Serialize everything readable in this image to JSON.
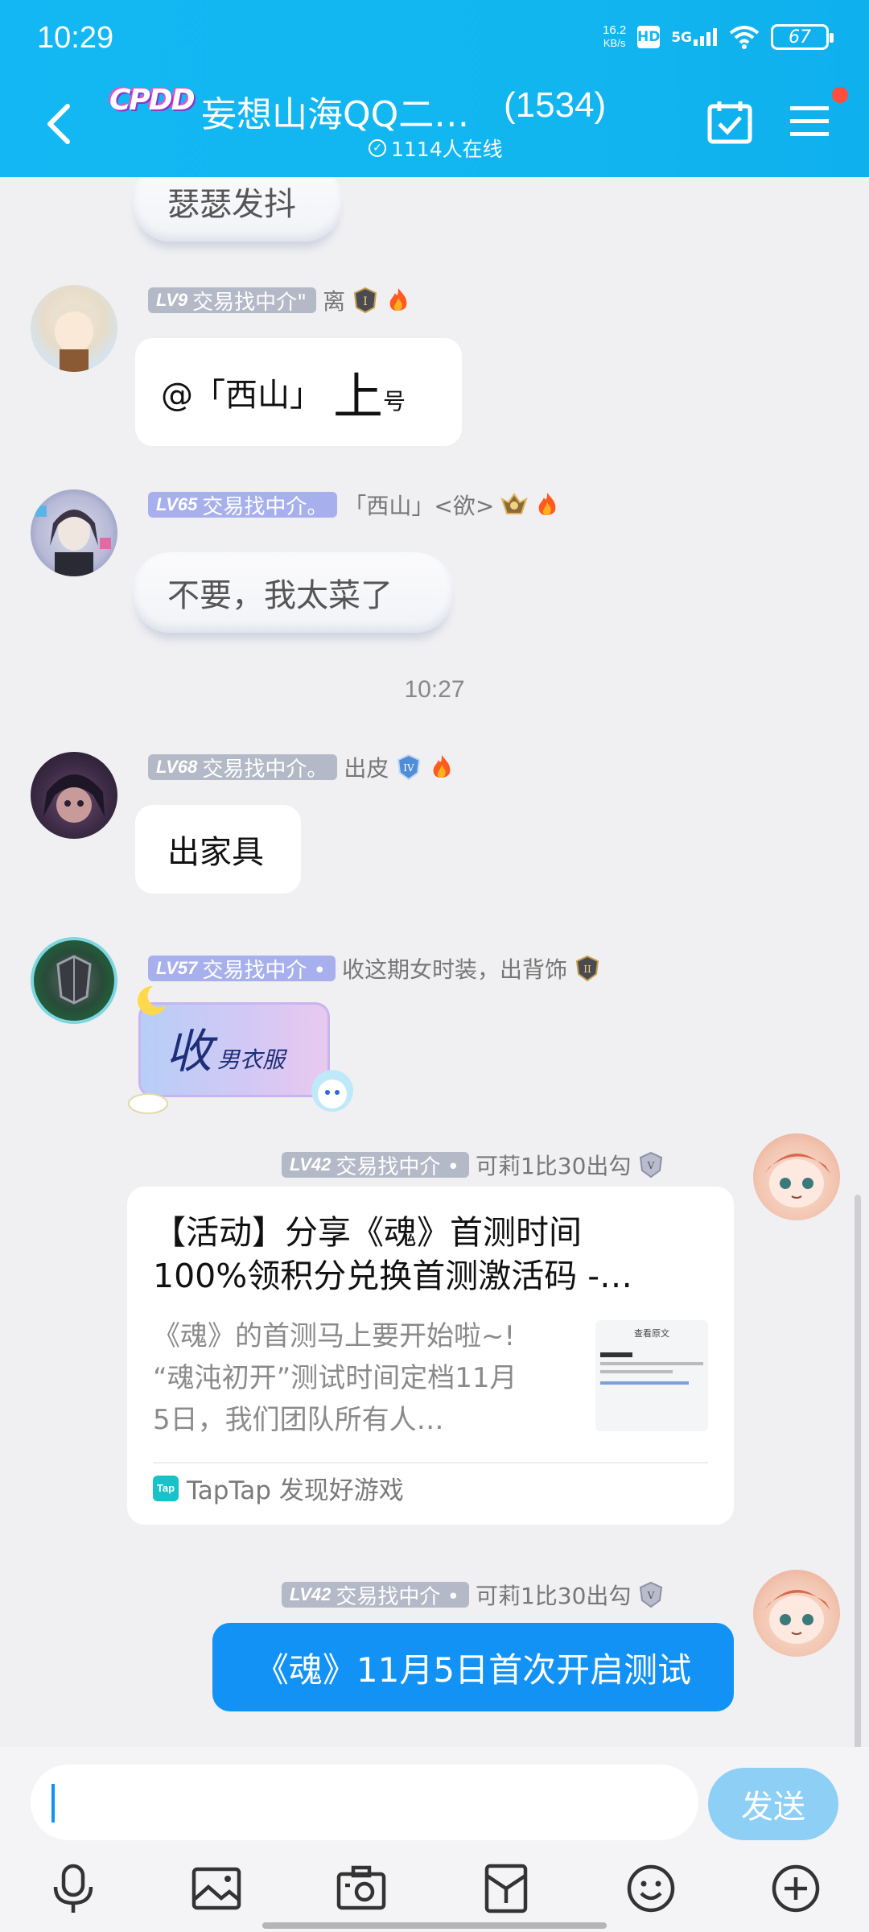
{
  "status_bar": {
    "time": "10:29",
    "net_speed": "16.2",
    "net_unit": "KB/s",
    "hd": "HD",
    "network": "5G",
    "battery": "67"
  },
  "header": {
    "logo": "CPDD",
    "title": "妄想山海QQ二…",
    "member_count": "(1534)",
    "online": "1114人在线"
  },
  "messages": [
    {
      "text": "瑟瑟发抖"
    },
    {
      "level": "LV9",
      "title": "交易找中介\"",
      "nick": "离",
      "text_main": "@「西山」",
      "text_big": "上",
      "text_small": "号"
    },
    {
      "level": "LV65",
      "title": "交易找中介。",
      "nick": "「西山」<欲>",
      "text": "不要，我太菜了"
    },
    {
      "level": "LV68",
      "title": "交易找中介。",
      "nick": "出皮",
      "text": "出家具"
    },
    {
      "level": "LV57",
      "title": "交易找中介 •",
      "nick": "收这期女时装，出背饰",
      "sticker_main": "收",
      "sticker_sub": "男衣服"
    },
    {
      "level": "LV42",
      "title": "交易找中介 •",
      "nick": "可莉1比30出勾"
    },
    {
      "level": "LV42",
      "title": "交易找中介 •",
      "nick": "可莉1比30出勾",
      "text": "《魂》11月5日首次开启测试"
    }
  ],
  "timestamp": "10:27",
  "share_card": {
    "title_line1": "【活动】分享《魂》首测时间",
    "title_line2": "100%领积分兑换首测激活码 -…",
    "desc_line1": "《魂》的首测马上要开始啦~!",
    "desc_line2": "“魂沌初开”测试时间定档11月",
    "desc_line3": "5日，我们团队所有人…",
    "thumb_title": "查看原文",
    "source_icon": "Tap",
    "source": "TapTap 发现好游戏"
  },
  "input": {
    "placeholder": "",
    "send_label": "发送"
  },
  "colors": {
    "header": "#13b7f3",
    "accent": "#1292f5",
    "send_disabled": "#8ecff6"
  }
}
